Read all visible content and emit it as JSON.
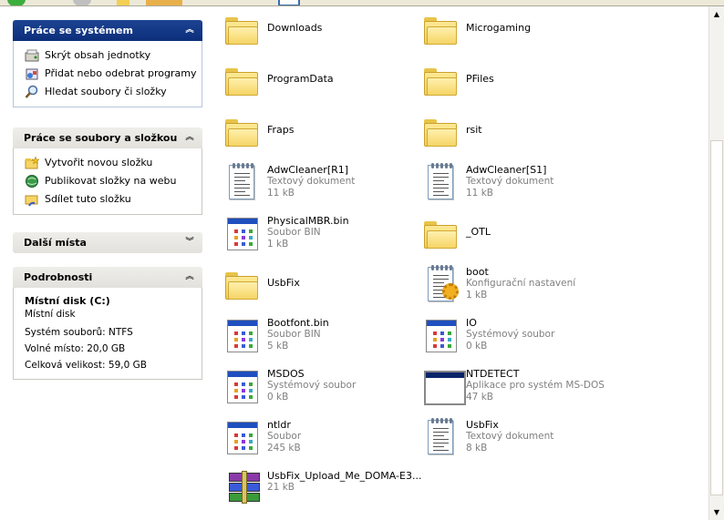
{
  "colors": {
    "panel_blue": "#0c2e7a",
    "panel_gray": "#e3e1dc",
    "subtext": "#808080"
  },
  "tasks_system": {
    "title": "Práce se systémem",
    "items": [
      {
        "label": "Skrýt obsah jednotky",
        "icon": "hide-drive-icon"
      },
      {
        "label": "Přidat nebo odebrat programy",
        "icon": "add-remove-programs-icon"
      },
      {
        "label": "Hledat soubory či složky",
        "icon": "search-icon"
      }
    ]
  },
  "tasks_files": {
    "title": "Práce se soubory a složkou",
    "items": [
      {
        "label": "Vytvořit novou složku",
        "icon": "new-folder-icon"
      },
      {
        "label": "Publikovat složky na webu",
        "icon": "publish-web-icon"
      },
      {
        "label": "Sdílet tuto složku",
        "icon": "share-folder-icon"
      }
    ]
  },
  "other_places": {
    "title": "Další místa"
  },
  "details": {
    "title": "Podrobnosti",
    "name": "Místní disk (C:)",
    "type": "Místní disk",
    "filesystem": "Systém souborů: NTFS",
    "free": "Volné místo: 20,0 GB",
    "total": "Celková velikost: 59,0 GB"
  },
  "files": [
    {
      "name": "Downloads",
      "kind": "folder"
    },
    {
      "name": "Microgaming",
      "kind": "folder"
    },
    {
      "name": "ProgramData",
      "kind": "folder"
    },
    {
      "name": "PFiles",
      "kind": "folder"
    },
    {
      "name": "Fraps",
      "kind": "folder"
    },
    {
      "name": "rsit",
      "kind": "folder"
    },
    {
      "name": "AdwCleaner[R1]",
      "type": "Textový dokument",
      "size": "11 kB",
      "kind": "text"
    },
    {
      "name": "AdwCleaner[S1]",
      "type": "Textový dokument",
      "size": "11 kB",
      "kind": "text"
    },
    {
      "name": "PhysicalMBR.bin",
      "type": "Soubor BIN",
      "size": "1 kB",
      "kind": "system"
    },
    {
      "name": "_OTL",
      "kind": "folder"
    },
    {
      "name": "UsbFix",
      "kind": "folder"
    },
    {
      "name": "boot",
      "type": "Konfigurační nastavení",
      "size": "1 kB",
      "kind": "config"
    },
    {
      "name": "Bootfont.bin",
      "type": "Soubor BIN",
      "size": "5 kB",
      "kind": "system"
    },
    {
      "name": "IO",
      "type": "Systémový soubor",
      "size": "0 kB",
      "kind": "system"
    },
    {
      "name": "MSDOS",
      "type": "Systémový soubor",
      "size": "0 kB",
      "kind": "system"
    },
    {
      "name": "NTDETECT",
      "type": "Aplikace pro systém MS-DOS",
      "size": "47 kB",
      "kind": "dos"
    },
    {
      "name": "ntldr",
      "type": "Soubor",
      "size": "245 kB",
      "kind": "system"
    },
    {
      "name": "UsbFix",
      "type": "Textový dokument",
      "size": "8 kB",
      "kind": "text"
    },
    {
      "name": "UsbFix_Upload_Me_DOMA-E3...",
      "size": "21 kB",
      "kind": "archive"
    }
  ]
}
